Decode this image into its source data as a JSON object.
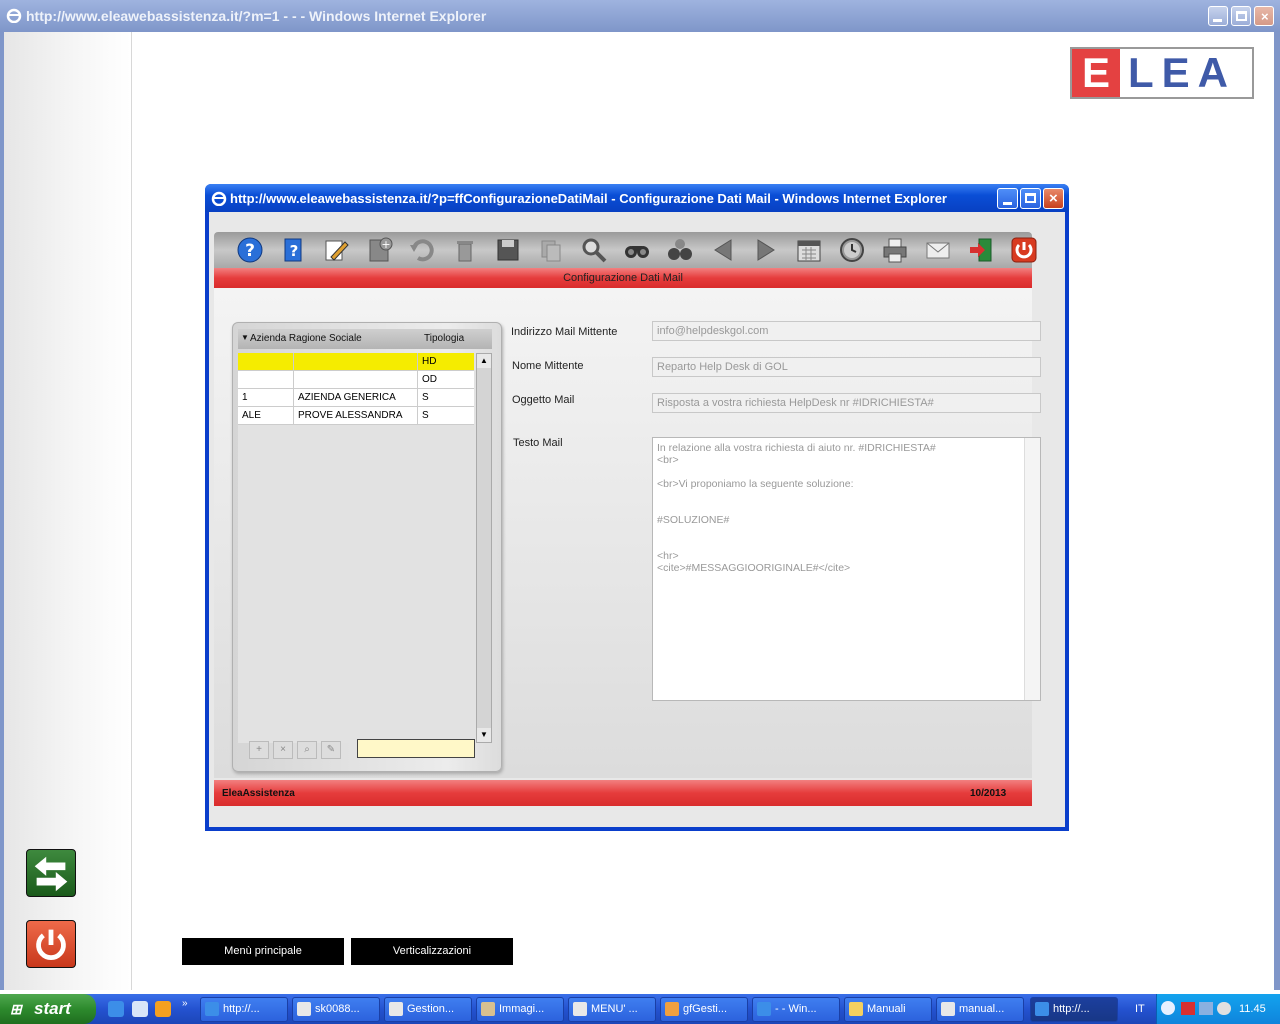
{
  "outer_window": {
    "title": "http://www.eleawebassistenza.it/?m=1 - - - Windows Internet Explorer"
  },
  "logo": {
    "text": "ELEA"
  },
  "inner_window": {
    "title": "http://www.eleawebassistenza.it/?p=ffConfigurazioneDatiMail - Configurazione Dati Mail - Windows Internet Explorer"
  },
  "toolbar": {
    "icons": [
      "help-icon",
      "info-icon",
      "edit-icon",
      "new-icon",
      "undo-icon",
      "delete-icon",
      "save-icon",
      "copy-icon",
      "search-icon",
      "find-icon",
      "advanced-search-icon",
      "prev-icon",
      "next-icon",
      "calendar-icon",
      "clock-icon",
      "print-icon",
      "mail-icon",
      "exit-icon",
      "power-icon"
    ]
  },
  "page": {
    "title": "Configurazione Dati Mail"
  },
  "grid": {
    "headers": {
      "col1": "Azienda Ragione Sociale",
      "col2": "Tipologia"
    },
    "rows": [
      {
        "code": "",
        "name": "",
        "type": "HD"
      },
      {
        "code": "",
        "name": "",
        "type": "OD"
      },
      {
        "code": "1",
        "name": "AZIENDA GENERICA",
        "type": "S"
      },
      {
        "code": "ALE",
        "name": "PROVE ALESSANDRA",
        "type": "S"
      }
    ],
    "buttons": {
      "add": "+",
      "remove": "×",
      "search": "⌕",
      "edit": "✎"
    }
  },
  "form": {
    "sender_address": {
      "label": "Indirizzo Mail Mittente",
      "value": "info@helpdeskgol.com"
    },
    "sender_name": {
      "label": "Nome Mittente",
      "value": "Reparto Help Desk di GOL"
    },
    "subject": {
      "label": "Oggetto Mail",
      "value": "Risposta a vostra richiesta HelpDesk nr #IDRICHIESTA#"
    },
    "body": {
      "label": "Testo Mail",
      "value": "In relazione alla vostra richiesta di aiuto nr. #IDRICHIESTA#\n<br>\n\n<br>Vi proponiamo la seguente soluzione:\n\n\n#SOLUZIONE#\n\n\n<hr>\n<cite>#MESSAGGIOORIGINALE#</cite>"
    }
  },
  "footer": {
    "left": "EleaAssistenza",
    "right": "10/2013"
  },
  "bottom_buttons": {
    "menu": "Menù principale",
    "vert": "Verticalizzazioni"
  },
  "taskbar": {
    "start": "start",
    "tasks": [
      "http://...",
      "sk0088...",
      "Gestion...",
      "Immagi...",
      "MENU' ...",
      "gfGesti...",
      "- - Win...",
      "Manuali",
      "manual...",
      "http://..."
    ],
    "lang": "IT",
    "clock": "11.45"
  },
  "colors": {
    "accent_red": "#e63c3c",
    "selected_row": "#f5ec00",
    "xp_blue": "#2452d0"
  }
}
